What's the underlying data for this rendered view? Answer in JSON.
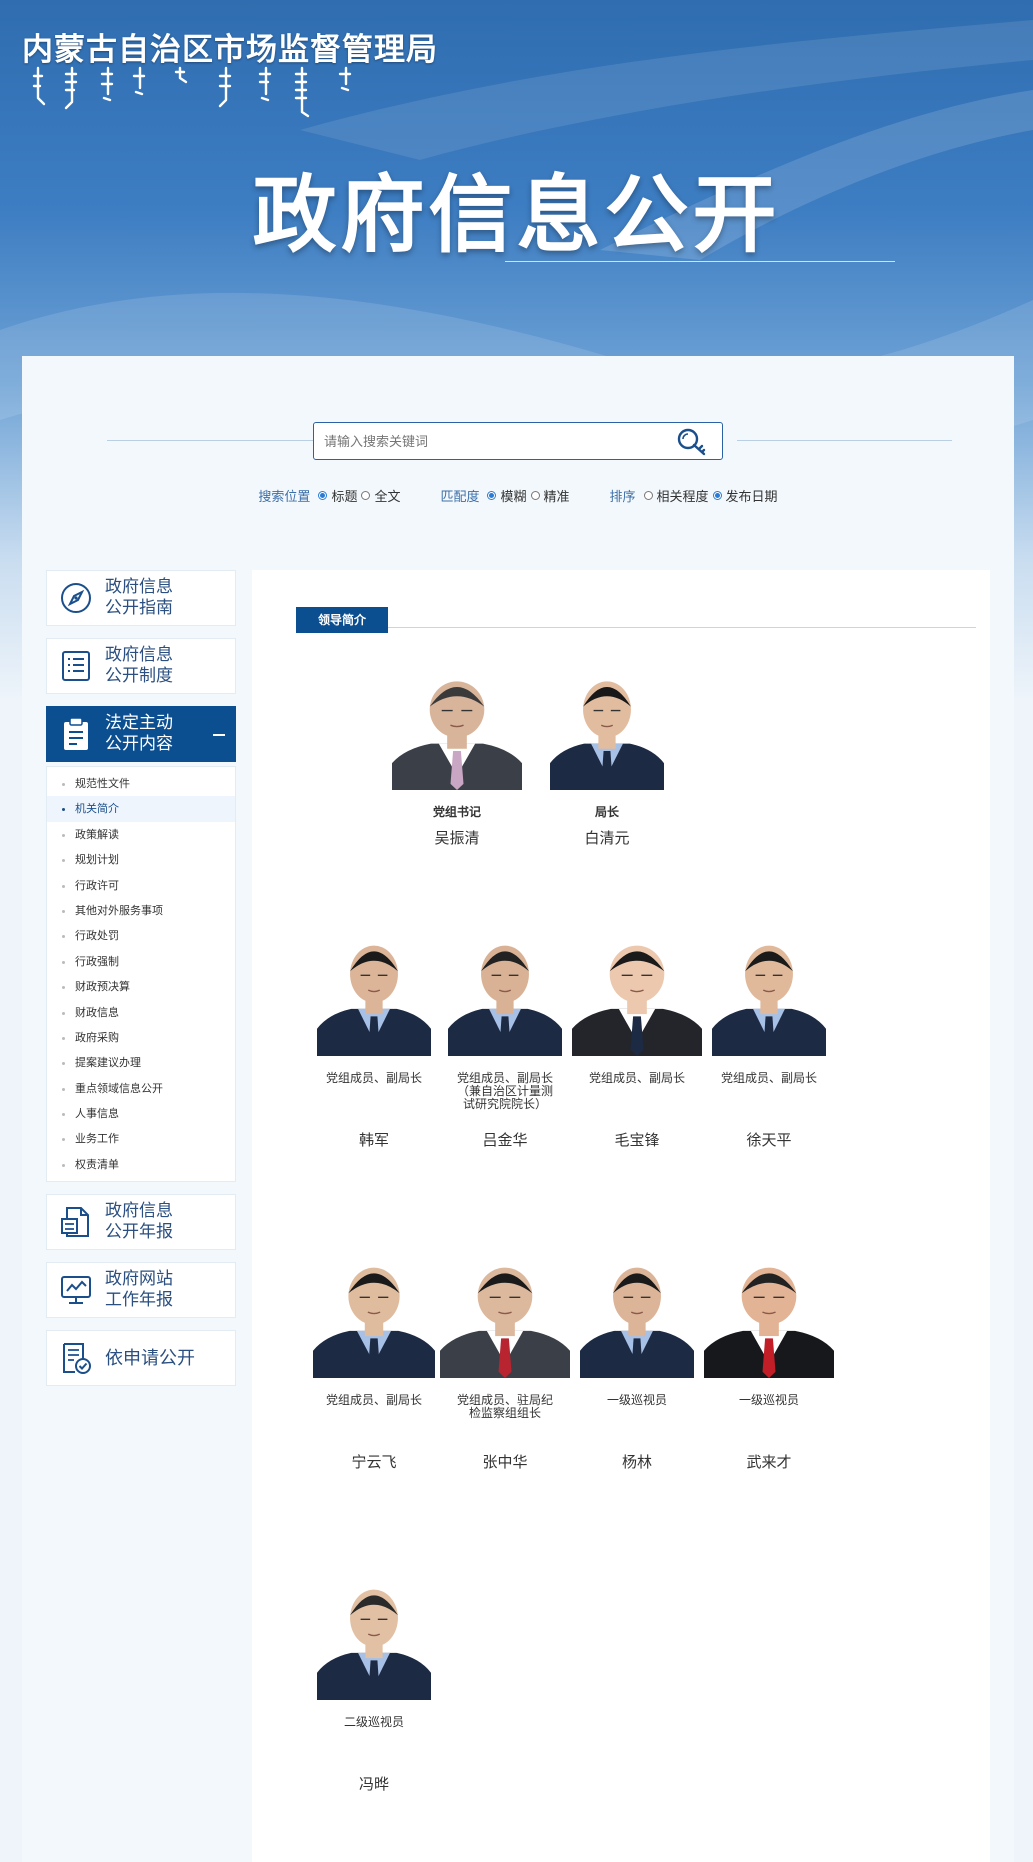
{
  "site": {
    "agency_title": "内蒙古自治区市场监督管理局",
    "hero_title": "政府信息公开"
  },
  "search": {
    "placeholder": "请输入搜索关键词",
    "position_label": "搜索位置",
    "position_options": [
      "标题",
      "全文"
    ],
    "position_selected": "标题",
    "match_label": "匹配度",
    "match_options": [
      "模糊",
      "精准"
    ],
    "match_selected": "模糊",
    "sort_label": "排序",
    "sort_options": [
      "相关程度",
      "发布日期"
    ],
    "sort_selected": "发布日期"
  },
  "sidebar": {
    "guide": {
      "line1": "政府信息",
      "line2": "公开指南"
    },
    "system": {
      "line1": "政府信息",
      "line2": "公开制度"
    },
    "statutory": {
      "line1": "法定主动",
      "line2": "公开内容"
    },
    "subitems": [
      "规范性文件",
      "机关简介",
      "政策解读",
      "规划计划",
      "行政许可",
      "其他对外服务事项",
      "行政处罚",
      "行政强制",
      "财政预决算",
      "财政信息",
      "政府采购",
      "提案建议办理",
      "重点领域信息公开",
      "人事信息",
      "业务工作",
      "权责清单"
    ],
    "active_subitem": "机关简介",
    "annual": {
      "line1": "政府信息",
      "line2": "公开年报"
    },
    "website": {
      "line1": "政府网站",
      "line2": "工作年报"
    },
    "apply": "依申请公开"
  },
  "content": {
    "tab_label": "领导简介",
    "leaders": [
      {
        "role": "党组书记",
        "name": "吴振清"
      },
      {
        "role": "局长",
        "name": "白清元"
      },
      {
        "role": "党组成员、副局长",
        "name": "韩军"
      },
      {
        "role_lines": [
          "党组成员、副局长",
          "（兼自治区计量测",
          "试研究院院长）"
        ],
        "name": "吕金华"
      },
      {
        "role": "党组成员、副局长",
        "name": "毛宝锋"
      },
      {
        "role": "党组成员、副局长",
        "name": "徐天平"
      },
      {
        "role": "党组成员、副局长",
        "name": "宁云飞"
      },
      {
        "role_lines": [
          "党组成员、驻局纪",
          "检监察组组长"
        ],
        "name": "张中华"
      },
      {
        "role": "一级巡视员",
        "name": "杨林"
      },
      {
        "role": "一级巡视员",
        "name": "武来才"
      },
      {
        "role": "二级巡视员",
        "name": "冯晔"
      }
    ]
  },
  "colors": {
    "primary": "#0c4f91",
    "banner_top": "#2f6db0",
    "link": "#2a4f80"
  }
}
